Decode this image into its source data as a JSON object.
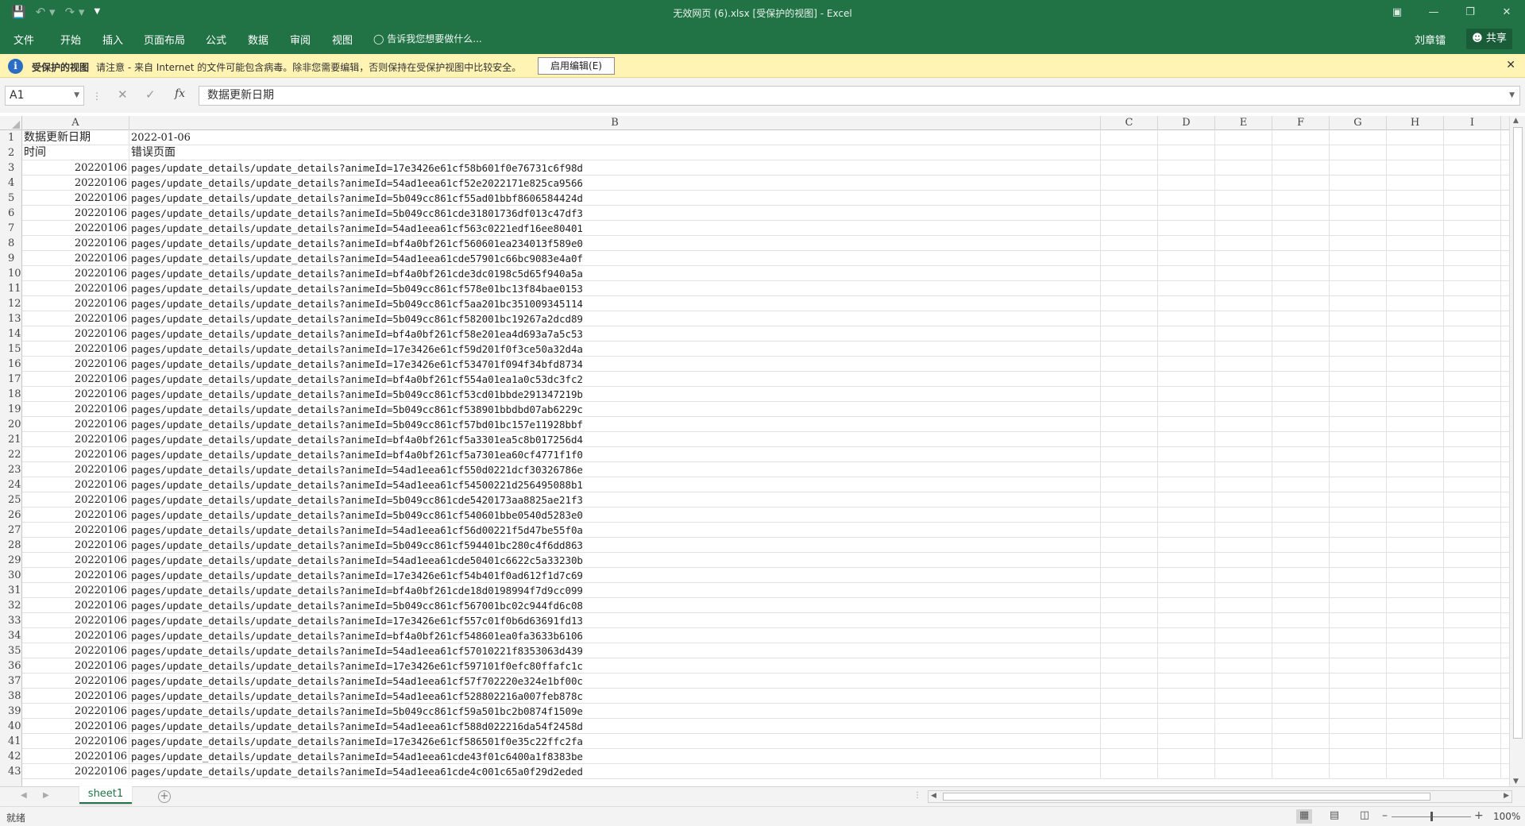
{
  "window": {
    "title": "无效网页 (6).xlsx  [受保护的视图] - Excel"
  },
  "ribbon": {
    "tabs": [
      "文件",
      "开始",
      "插入",
      "页面布局",
      "公式",
      "数据",
      "审阅",
      "视图"
    ],
    "tell_me": "告诉我您想要做什么...",
    "user_name": "刘章镭",
    "share_label": "共享"
  },
  "protected_view": {
    "title": "受保护的视图",
    "message": "请注意 - 来自 Internet 的文件可能包含病毒。除非您需要编辑，否则保持在受保护视图中比较安全。",
    "enable_button": "启用编辑(E)"
  },
  "formula_bar": {
    "name_box": "A1",
    "fx_label": "fx",
    "content": "数据更新日期"
  },
  "grid": {
    "columns": [
      "A",
      "B",
      "C",
      "D",
      "E",
      "F",
      "G",
      "H",
      "I"
    ],
    "rows": [
      {
        "n": "1",
        "a": "数据更新日期",
        "b": "2022-01-06"
      },
      {
        "n": "2",
        "a": "时间",
        "b": "错误页面"
      },
      {
        "n": "3",
        "a": "20220106",
        "b": "pages/update_details/update_details?animeId=17e3426e61cf58b601f0e76731c6f98d"
      },
      {
        "n": "4",
        "a": "20220106",
        "b": "pages/update_details/update_details?animeId=54ad1eea61cf52e2022171e825ca9566"
      },
      {
        "n": "5",
        "a": "20220106",
        "b": "pages/update_details/update_details?animeId=5b049cc861cf55ad01bbf8606584424d"
      },
      {
        "n": "6",
        "a": "20220106",
        "b": "pages/update_details/update_details?animeId=5b049cc861cde31801736df013c47df3"
      },
      {
        "n": "7",
        "a": "20220106",
        "b": "pages/update_details/update_details?animeId=54ad1eea61cf563c0221edf16ee80401"
      },
      {
        "n": "8",
        "a": "20220106",
        "b": "pages/update_details/update_details?animeId=bf4a0bf261cf560601ea234013f589e0"
      },
      {
        "n": "9",
        "a": "20220106",
        "b": "pages/update_details/update_details?animeId=54ad1eea61cde57901c66bc9083e4a0f"
      },
      {
        "n": "10",
        "a": "20220106",
        "b": "pages/update_details/update_details?animeId=bf4a0bf261cde3dc0198c5d65f940a5a"
      },
      {
        "n": "11",
        "a": "20220106",
        "b": "pages/update_details/update_details?animeId=5b049cc861cf578e01bc13f84bae0153"
      },
      {
        "n": "12",
        "a": "20220106",
        "b": "pages/update_details/update_details?animeId=5b049cc861cf5aa201bc351009345114"
      },
      {
        "n": "13",
        "a": "20220106",
        "b": "pages/update_details/update_details?animeId=5b049cc861cf582001bc19267a2dcd89"
      },
      {
        "n": "14",
        "a": "20220106",
        "b": "pages/update_details/update_details?animeId=bf4a0bf261cf58e201ea4d693a7a5c53"
      },
      {
        "n": "15",
        "a": "20220106",
        "b": "pages/update_details/update_details?animeId=17e3426e61cf59d201f0f3ce50a32d4a"
      },
      {
        "n": "16",
        "a": "20220106",
        "b": "pages/update_details/update_details?animeId=17e3426e61cf534701f094f34bfd8734"
      },
      {
        "n": "17",
        "a": "20220106",
        "b": "pages/update_details/update_details?animeId=bf4a0bf261cf554a01ea1a0c53dc3fc2"
      },
      {
        "n": "18",
        "a": "20220106",
        "b": "pages/update_details/update_details?animeId=5b049cc861cf53cd01bbde291347219b"
      },
      {
        "n": "19",
        "a": "20220106",
        "b": "pages/update_details/update_details?animeId=5b049cc861cf538901bbdbd07ab6229c"
      },
      {
        "n": "20",
        "a": "20220106",
        "b": "pages/update_details/update_details?animeId=5b049cc861cf57bd01bc157e11928bbf"
      },
      {
        "n": "21",
        "a": "20220106",
        "b": "pages/update_details/update_details?animeId=bf4a0bf261cf5a3301ea5c8b017256d4"
      },
      {
        "n": "22",
        "a": "20220106",
        "b": "pages/update_details/update_details?animeId=bf4a0bf261cf5a7301ea60cf4771f1f0"
      },
      {
        "n": "23",
        "a": "20220106",
        "b": "pages/update_details/update_details?animeId=54ad1eea61cf550d0221dcf30326786e"
      },
      {
        "n": "24",
        "a": "20220106",
        "b": "pages/update_details/update_details?animeId=54ad1eea61cf54500221d256495088b1"
      },
      {
        "n": "25",
        "a": "20220106",
        "b": "pages/update_details/update_details?animeId=5b049cc861cde5420173aa8825ae21f3"
      },
      {
        "n": "26",
        "a": "20220106",
        "b": "pages/update_details/update_details?animeId=5b049cc861cf540601bbe0540d5283e0"
      },
      {
        "n": "27",
        "a": "20220106",
        "b": "pages/update_details/update_details?animeId=54ad1eea61cf56d00221f5d47be55f0a"
      },
      {
        "n": "28",
        "a": "20220106",
        "b": "pages/update_details/update_details?animeId=5b049cc861cf594401bc280c4f6dd863"
      },
      {
        "n": "29",
        "a": "20220106",
        "b": "pages/update_details/update_details?animeId=54ad1eea61cde50401c6622c5a33230b"
      },
      {
        "n": "30",
        "a": "20220106",
        "b": "pages/update_details/update_details?animeId=17e3426e61cf54b401f0ad612f1d7c69"
      },
      {
        "n": "31",
        "a": "20220106",
        "b": "pages/update_details/update_details?animeId=bf4a0bf261cde18d0198994f7d9cc099"
      },
      {
        "n": "32",
        "a": "20220106",
        "b": "pages/update_details/update_details?animeId=5b049cc861cf567001bc02c944fd6c08"
      },
      {
        "n": "33",
        "a": "20220106",
        "b": "pages/update_details/update_details?animeId=17e3426e61cf557c01f0b6d63691fd13"
      },
      {
        "n": "34",
        "a": "20220106",
        "b": "pages/update_details/update_details?animeId=bf4a0bf261cf548601ea0fa3633b6106"
      },
      {
        "n": "35",
        "a": "20220106",
        "b": "pages/update_details/update_details?animeId=54ad1eea61cf57010221f8353063d439"
      },
      {
        "n": "36",
        "a": "20220106",
        "b": "pages/update_details/update_details?animeId=17e3426e61cf597101f0efc80ffafc1c"
      },
      {
        "n": "37",
        "a": "20220106",
        "b": "pages/update_details/update_details?animeId=54ad1eea61cf57f702220e324e1bf00c"
      },
      {
        "n": "38",
        "a": "20220106",
        "b": "pages/update_details/update_details?animeId=54ad1eea61cf528802216a007feb878c"
      },
      {
        "n": "39",
        "a": "20220106",
        "b": "pages/update_details/update_details?animeId=5b049cc861cf59a501bc2b0874f1509e"
      },
      {
        "n": "40",
        "a": "20220106",
        "b": "pages/update_details/update_details?animeId=54ad1eea61cf588d022216da54f2458d"
      },
      {
        "n": "41",
        "a": "20220106",
        "b": "pages/update_details/update_details?animeId=17e3426e61cf586501f0e35c22ffc2fa"
      },
      {
        "n": "42",
        "a": "20220106",
        "b": "pages/update_details/update_details?animeId=54ad1eea61cde43f01c6400a1f8383be"
      },
      {
        "n": "43",
        "a": "20220106",
        "b": "pages/update_details/update_details?animeId=54ad1eea61cde4c001c65a0f29d2eded"
      }
    ]
  },
  "sheets": {
    "active": "sheet1"
  },
  "status": {
    "text": "就绪",
    "zoom": "100%",
    "zoom_level": 1.0
  }
}
